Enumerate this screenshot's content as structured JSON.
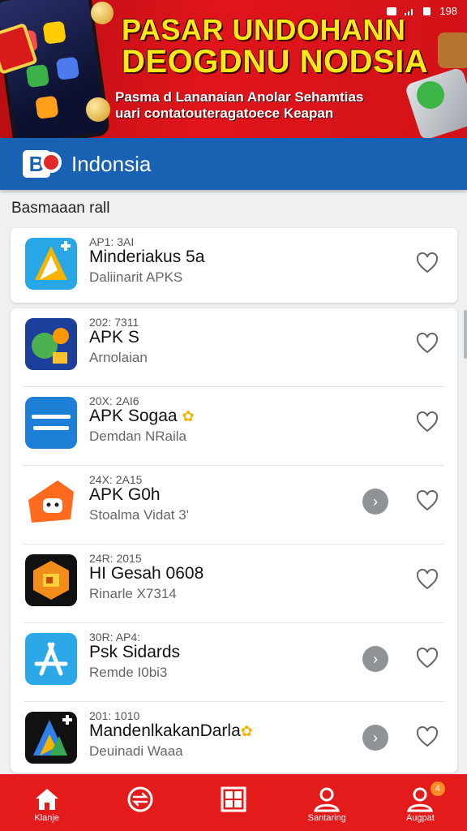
{
  "status_bar": {
    "time": "198"
  },
  "banner": {
    "title_line1": "PASAR UNDOHANN",
    "title_line2": "DEOGDNU NODSIA",
    "subtitle_line1": "Pasma d Lananaian Anolar Sehamtias",
    "subtitle_line2": "uari contatouteragatoece Keapan"
  },
  "appbar": {
    "logo_letter": "B",
    "title": "Indonsia"
  },
  "section": {
    "title": "Basmaaan rall"
  },
  "apps": [
    {
      "meta": "AP1: 3AI",
      "name": "Minderiakus 5a",
      "sub": "Daliinarit APKS",
      "has_arrow": false,
      "icon_colors": [
        "#27a7e6",
        "#f4b400"
      ]
    },
    {
      "meta": "202: 7311",
      "name": "APK S",
      "sub": "Arnolaian",
      "has_arrow": false,
      "icon_colors": [
        "#1b3f9b",
        "#4caf50"
      ]
    },
    {
      "meta": "20X: 2AI6",
      "name": "APK Sogaa",
      "badge": "✿",
      "sub": "Demdan NRaila",
      "has_arrow": false,
      "icon_colors": [
        "#1e7fd6",
        "#1e7fd6"
      ]
    },
    {
      "meta": "24X: 2A15",
      "name": "APK G0h",
      "sub": "Stoalma Vidat 3'",
      "has_arrow": true,
      "icon_colors": [
        "#ff6a1f",
        "#ffffff"
      ]
    },
    {
      "meta": "24R: 2015",
      "name": "HI Gesah 0608",
      "sub": "Rinarle X7314",
      "has_arrow": false,
      "icon_colors": [
        "#111111",
        "#f28c1b"
      ]
    },
    {
      "meta": "30R: AP4:",
      "name": "Psk Sidards",
      "sub": "Remde I0bi3",
      "has_arrow": true,
      "icon_colors": [
        "#2aa8e8",
        "#ffffff"
      ]
    },
    {
      "meta": "201: 1010",
      "name": "MandenlkakanDarla",
      "badge": "✿",
      "sub": "Deuinadi Waaa",
      "has_arrow": true,
      "icon_colors": [
        "#111111",
        "#2f80ed"
      ]
    }
  ],
  "nav": {
    "items": [
      {
        "label": "Klanje",
        "icon": "home-icon"
      },
      {
        "label": "",
        "icon": "transfer-icon"
      },
      {
        "label": "",
        "icon": "grid-icon"
      },
      {
        "label": "Santaring",
        "icon": "user-icon"
      },
      {
        "label": "Augpat",
        "icon": "profile-icon",
        "badge": "4"
      }
    ]
  }
}
